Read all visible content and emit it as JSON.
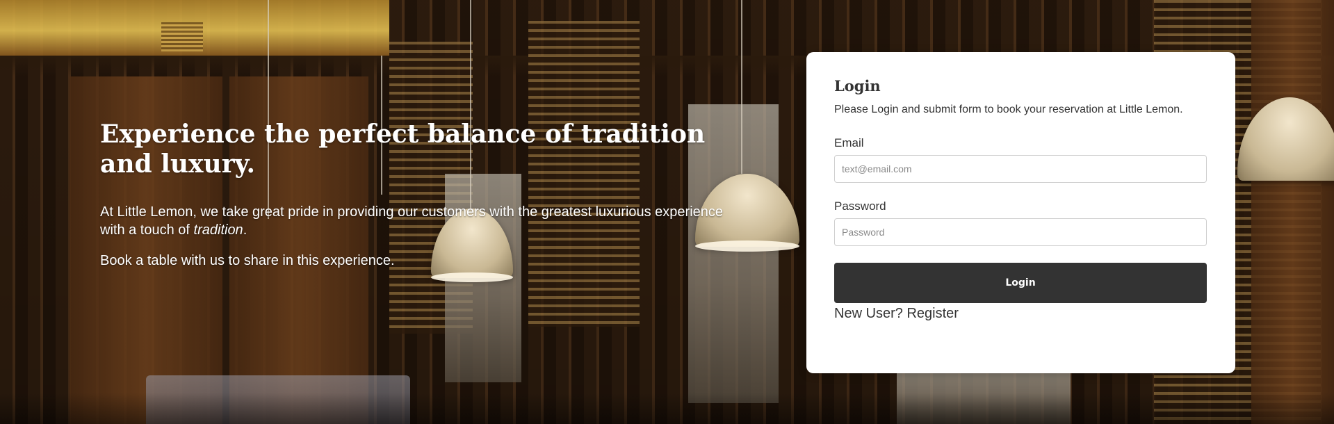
{
  "hero": {
    "headline": "Experience the perfect balance of tradition and luxury.",
    "paragraph1_prefix": "At Little Lemon, we take great pride in providing our customers with the greatest luxurious experience with a touch of ",
    "paragraph1_emphasis": "tradition",
    "paragraph1_suffix": ".",
    "paragraph2": "Book a table with us to share in this experience."
  },
  "login": {
    "title": "Login",
    "subtitle": "Please Login and submit form to book your reservation at Little Lemon.",
    "email_label": "Email",
    "email_placeholder": "text@email.com",
    "email_value": "",
    "password_label": "Password",
    "password_placeholder": "Password",
    "password_value": "",
    "button_label": "Login",
    "register_link": "New User? Register"
  },
  "colors": {
    "card_background": "#ffffff",
    "button_background": "#333333",
    "button_text": "#ffffff",
    "text_dark": "#333333",
    "hero_text": "#ffffff"
  }
}
